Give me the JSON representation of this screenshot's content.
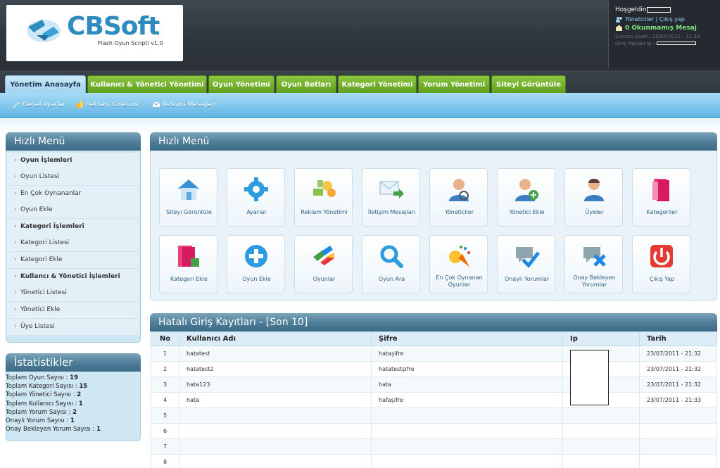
{
  "header": {
    "logo_text": "CBSoft",
    "logo_tagline": "Flash Oyun Scripti v1.0",
    "user_panel": {
      "greeting": "Hoşgeldin",
      "links": "Yöneticiler | Çıkış yap",
      "messages": "0 Okunmamış Mesaj",
      "server_time": "Sunucu Saati : 23/07/2011 - 21:33",
      "login_ip": "Giriş Yapılan Ip :"
    }
  },
  "tabs": [
    {
      "label": "Yönetim Anasayfa",
      "active": true
    },
    {
      "label": "Kullanıcı & Yönetici Yönetimi"
    },
    {
      "label": "Oyun Yönetimi"
    },
    {
      "label": "Oyun Botları"
    },
    {
      "label": "Kategori Yönetimi"
    },
    {
      "label": "Yorum Yönetimi"
    },
    {
      "label": "Siteyi Görüntüle"
    }
  ],
  "subnav": [
    {
      "label": "Genel Ayarlar",
      "icon": "wrench-icon"
    },
    {
      "label": "Reklam Yönetimi",
      "icon": "ad-icon"
    },
    {
      "label": "İletişim Mesajları",
      "icon": "mail-icon"
    }
  ],
  "sidebar": {
    "title": "Hızlı Menü",
    "items": [
      {
        "label": "Oyun İşlemleri",
        "bold": true
      },
      {
        "label": "Oyun Listesi"
      },
      {
        "label": "En Çok Oynananlar"
      },
      {
        "label": "Oyun Ekle"
      },
      {
        "label": "Kategori İşlemleri",
        "bold": true
      },
      {
        "label": "Kategori Listesi"
      },
      {
        "label": "Kategori Ekle"
      },
      {
        "label": "Kullancı & Yönetici İşlemleri",
        "bold": true
      },
      {
        "label": "Yönetici Listesi"
      },
      {
        "label": "Yönetici Ekle"
      },
      {
        "label": "Üye Listesi"
      }
    ]
  },
  "stats": {
    "title": "İstatistikler",
    "rows": [
      {
        "label": "Toplam Oyun Sayısı : ",
        "value": "19"
      },
      {
        "label": "Toplam Kategori Sayısı : ",
        "value": "15"
      },
      {
        "label": "Toplam Yönetici Sayısı : ",
        "value": "2"
      },
      {
        "label": "Toplam Kullanıcı Sayısı : ",
        "value": "1"
      },
      {
        "label": "Toplam Yorum Sayısı : ",
        "value": "2"
      },
      {
        "label": "Onaylı Yorum Sayısı : ",
        "value": "1"
      },
      {
        "label": "Onay Bekleyen Yorum Sayısı : ",
        "value": "1"
      }
    ]
  },
  "quick_menu": {
    "title": "Hızlı Menü",
    "tiles": [
      {
        "label": "Siteyi Görüntüle",
        "icon": "house-icon"
      },
      {
        "label": "Ayarlar",
        "icon": "gear-icon"
      },
      {
        "label": "Reklam Yönetimi",
        "icon": "money-icon"
      },
      {
        "label": "İletişim Mesajları",
        "icon": "mail-arrow-icon"
      },
      {
        "label": "Yöneticiler",
        "icon": "admin-user-icon"
      },
      {
        "label": "Yönetici Ekle",
        "icon": "add-admin-icon"
      },
      {
        "label": "Üyeler",
        "icon": "user-icon"
      },
      {
        "label": "Kategoriler",
        "icon": "folders-icon"
      },
      {
        "label": "Kategori Ekle",
        "icon": "add-category-icon"
      },
      {
        "label": "Oyun Ekle",
        "icon": "plus-circle-icon"
      },
      {
        "label": "Oyunlar",
        "icon": "cubes-icon"
      },
      {
        "label": "Oyun Ara",
        "icon": "magnifier-icon"
      },
      {
        "label": "En Çok Oynanan Oyunlar",
        "icon": "party-icon"
      },
      {
        "label": "Onaylı Yorumlar",
        "icon": "approved-comment-icon"
      },
      {
        "label": "Onay Bekleyen Yorumlar",
        "icon": "pending-comment-icon"
      },
      {
        "label": "Çıkış Yap",
        "icon": "power-icon"
      }
    ]
  },
  "login_log": {
    "title": "Hatalı Giriş Kayıtları - [Son 10]",
    "columns": [
      "No",
      "Kullanıcı Adı",
      "Şifre",
      "Ip",
      "Tarih"
    ],
    "rows": [
      [
        "1",
        "hatatest",
        "hataşifre",
        "",
        "23/07/2011 - 21:32"
      ],
      [
        "2",
        "hatatest2",
        "hatatestşifre",
        "",
        "23/07/2011 - 21:32"
      ],
      [
        "3",
        "hata123",
        "hata",
        "",
        "23/07/2011 - 21:32"
      ],
      [
        "4",
        "hata",
        "hafaşifre",
        "",
        "23/07/2011 - 21:33"
      ],
      [
        "5",
        "",
        "",
        "",
        ""
      ],
      [
        "6",
        "",
        "",
        "",
        ""
      ],
      [
        "7",
        "",
        "",
        "",
        ""
      ],
      [
        "8",
        "",
        "",
        "",
        ""
      ]
    ]
  },
  "colors": {
    "tab_green": "#6fae2a",
    "tab_active": "#b9e0f5",
    "subnav_blue": "#6cbce8",
    "panel_header": "#4d7c97",
    "link_blue": "#2f5f86"
  }
}
